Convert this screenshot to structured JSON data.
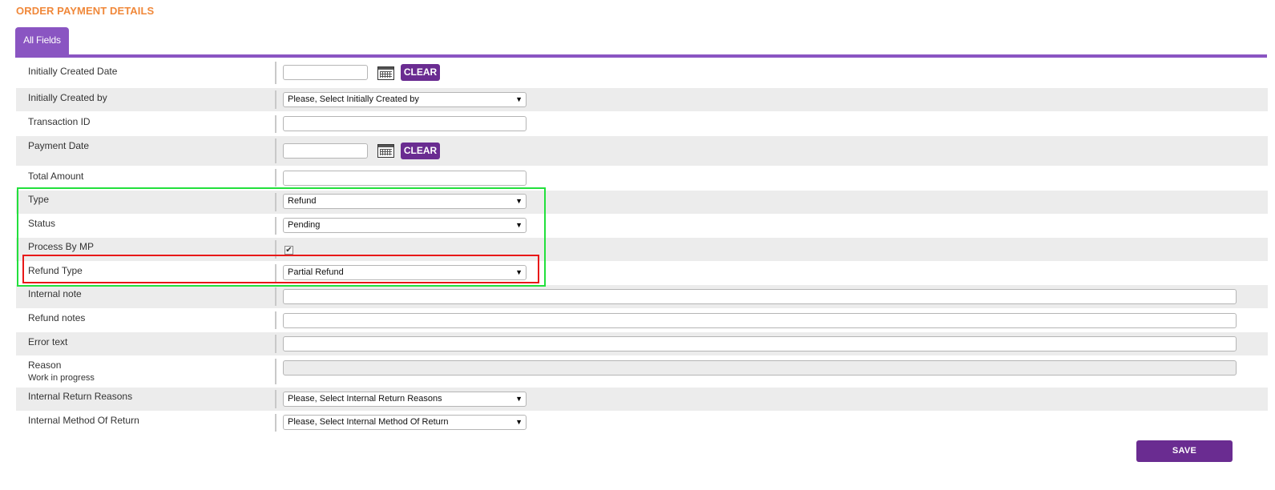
{
  "page": {
    "title": "ORDER PAYMENT DETAILS"
  },
  "tabs": [
    {
      "label": "All Fields",
      "active": true
    }
  ],
  "accent_color": "#8a55c2",
  "button_color": "#6a2c91",
  "title_color": "#f0883a",
  "highlight_colors": {
    "group": "#22e03c",
    "field": "#e81818"
  },
  "fields": {
    "initially_created_date": {
      "label": "Initially Created Date",
      "value": "",
      "clear_label": "CLEAR",
      "icon": "calendar-icon"
    },
    "initially_created_by": {
      "label": "Initially Created by",
      "value": "Please, Select Initially Created by"
    },
    "transaction_id": {
      "label": "Transaction ID",
      "value": ""
    },
    "payment_date": {
      "label": "Payment Date",
      "value": "",
      "clear_label": "CLEAR",
      "icon": "calendar-icon"
    },
    "total_amount": {
      "label": "Total Amount",
      "value": ""
    },
    "type": {
      "label": "Type",
      "value": "Refund"
    },
    "status": {
      "label": "Status",
      "value": "Pending"
    },
    "process_by_mp": {
      "label": "Process By MP",
      "checked": true
    },
    "refund_type": {
      "label": "Refund Type",
      "value": "Partial Refund"
    },
    "internal_note": {
      "label": "Internal note",
      "value": ""
    },
    "refund_notes": {
      "label": "Refund notes",
      "value": ""
    },
    "error_text": {
      "label": "Error text",
      "value": ""
    },
    "reason": {
      "label": "Reason",
      "sub_label": "Work in progress",
      "value": ""
    },
    "internal_return_reasons": {
      "label": "Internal Return Reasons",
      "value": "Please, Select Internal Return Reasons"
    },
    "internal_method_of_return": {
      "label": "Internal Method Of Return",
      "value": "Please, Select Internal Method Of Return"
    }
  },
  "actions": {
    "save_label": "SAVE"
  }
}
